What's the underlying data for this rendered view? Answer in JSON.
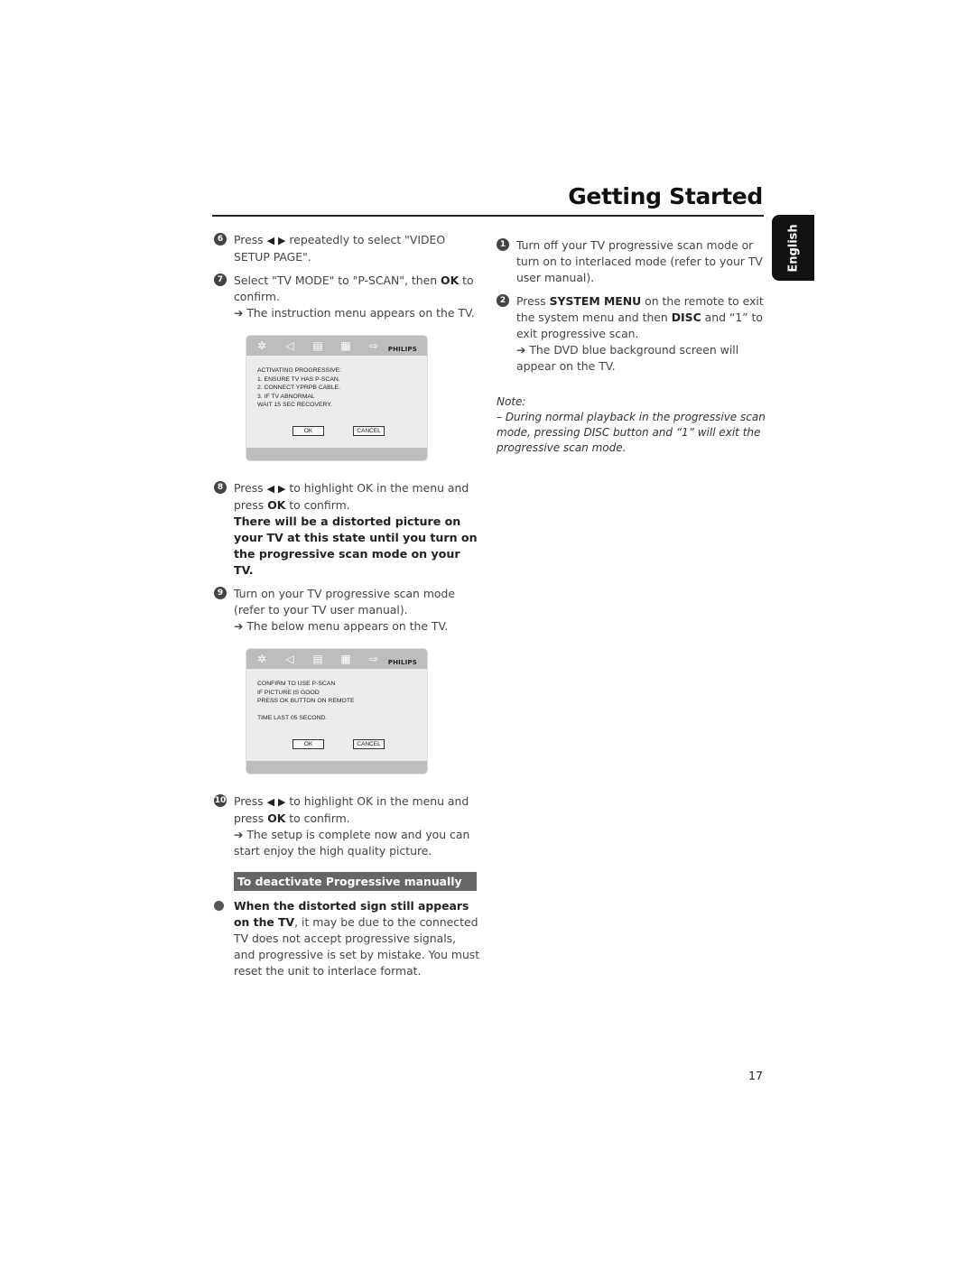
{
  "header": {
    "title": "Getting Started",
    "language_tab": "English"
  },
  "left_column": {
    "step6": {
      "num": "6",
      "pre": "Press",
      "text": "repeatedly to select \"VIDEO SETUP PAGE\"."
    },
    "step7": {
      "num": "7",
      "pre": "Select \"TV MODE\" to \"P-SCAN\", then",
      "bold": "OK",
      "post": "to confirm.",
      "result": "The instruction menu appears on the TV."
    },
    "menu1": {
      "brand": "PHILIPS",
      "lines": [
        "ACTIVATING PROGRESSIVE:",
        "1. ENSURE TV HAS P-SCAN.",
        "2. CONNECT YPRPB CABLE.",
        "3. IF TV ABNORMAL",
        "WAIT 15 SEC RECOVERY."
      ],
      "ok_label": "OK",
      "cancel_label": "CANCEL"
    },
    "step8": {
      "num": "8",
      "pre": "Press",
      "text": "to highlight OK in the menu and press",
      "bold": "OK",
      "post": "to confirm.",
      "warning": "There will be a distorted picture on your TV at this state until you turn on the progressive scan mode on your TV."
    },
    "step9": {
      "num": "9",
      "text": "Turn on your TV progressive scan mode (refer to your TV user manual).",
      "result": "The below menu appears on the TV."
    },
    "menu2": {
      "brand": "PHILIPS",
      "lines": [
        "CONFIRM TO USE P-SCAN",
        "IF PICTURE IS GOOD",
        "PRESS OK BUTTON ON REMOTE"
      ],
      "time_line": "TIME LAST 05 SECOND.",
      "ok_label": "OK",
      "cancel_label": "CANCEL"
    },
    "step10": {
      "num": "10",
      "pre": "Press",
      "text": "to highlight OK in the menu and press",
      "bold": "OK",
      "post": "to confirm.",
      "result": "The setup is complete now and you can start enjoy the high quality picture."
    },
    "section_title": "To deactivate Progressive manually",
    "bullet": {
      "bold": "When the distorted sign still appears on the TV",
      "text": ", it may be due to the connected TV does not accept progressive signals, and progressive is set by mistake. You must reset the unit to interlace format."
    }
  },
  "right_column": {
    "step1": {
      "num": "1",
      "text": "Turn off your TV progressive scan mode or turn on to interlaced mode (refer to your TV user manual)."
    },
    "step2": {
      "num": "2",
      "pre": "Press",
      "bold1": "SYSTEM MENU",
      "mid": "on the remote to exit the system menu and then",
      "bold2": "DISC",
      "post": "and “1” to exit progressive scan.",
      "result": "The DVD blue background screen will appear on the TV."
    },
    "note": {
      "label": "Note:",
      "text": "–  During normal playback in the progressive scan mode, pressing DISC button and “1” will exit the progressive scan mode."
    }
  },
  "icons": {
    "left": "◀",
    "right": "▶",
    "arrow": "➔"
  },
  "footer": {
    "page_number": "17"
  }
}
